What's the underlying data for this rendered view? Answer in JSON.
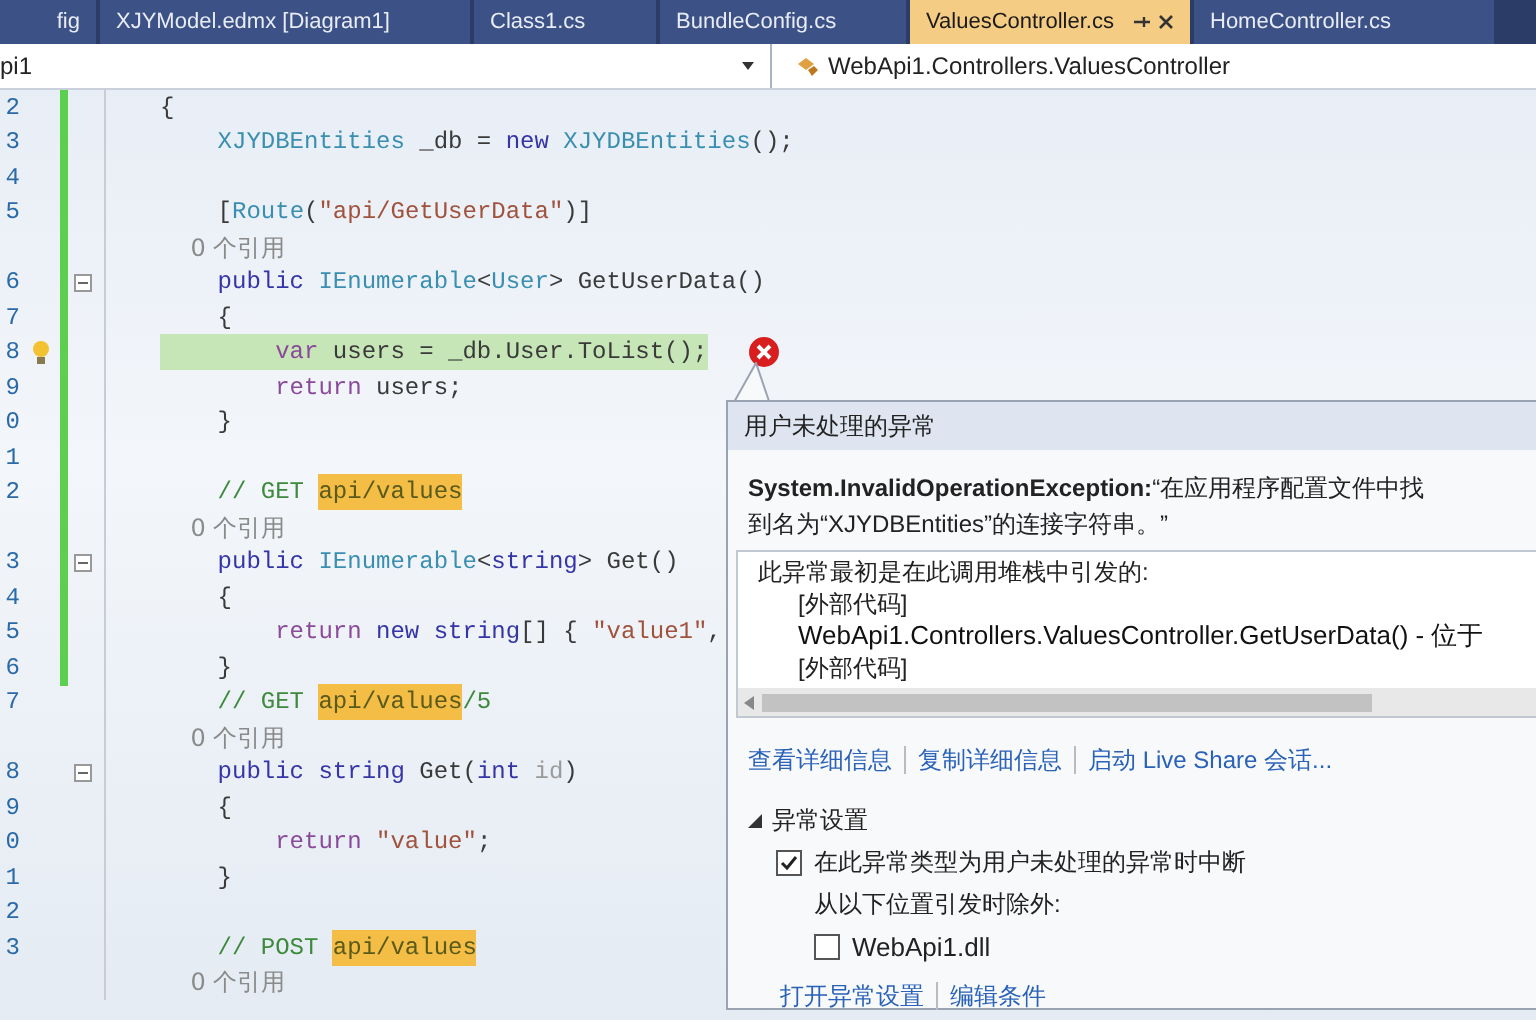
{
  "tabs": [
    {
      "label": "fig",
      "selected": false
    },
    {
      "label": "XJYModel.edmx [Diagram1]",
      "selected": false
    },
    {
      "label": "Class1.cs",
      "selected": false
    },
    {
      "label": "BundleConfig.cs",
      "selected": false
    },
    {
      "label": "ValuesController.cs",
      "selected": true
    },
    {
      "label": "HomeController.cs",
      "selected": false
    }
  ],
  "nav_bar": {
    "project": "pi1",
    "class": "WebApi1.Controllers.ValuesController"
  },
  "code_lines": [
    {
      "number": "2",
      "changed": true,
      "tokens": [
        {
          "kind": "plain",
          "text": "{"
        }
      ]
    },
    {
      "number": "3",
      "changed": true,
      "tokens": [
        {
          "kind": "type",
          "text": "    XJYDBEntities"
        },
        {
          "kind": "plain",
          "text": " _db = "
        },
        {
          "kind": "keyword",
          "text": "new"
        },
        {
          "kind": "type",
          "text": " XJYDBEntities"
        },
        {
          "kind": "plain",
          "text": "();"
        }
      ]
    },
    {
      "number": "4",
      "changed": true
    },
    {
      "number": "5",
      "changed": true,
      "tokens": [
        {
          "kind": "plain",
          "text": "    ["
        },
        {
          "kind": "type",
          "text": "Route"
        },
        {
          "kind": "plain",
          "text": "("
        },
        {
          "kind": "string",
          "text": "\"api/GetUserData\""
        },
        {
          "kind": "plain",
          "text": ")]"
        }
      ]
    },
    {
      "changed": true,
      "tokens": [
        {
          "kind": "reference",
          "text": "    0 个引用"
        }
      ]
    },
    {
      "number": "6",
      "changed": true,
      "fold": true,
      "tokens": [
        {
          "kind": "keyword",
          "text": "    public"
        },
        {
          "kind": "type",
          "text": " IEnumerable"
        },
        {
          "kind": "plain",
          "text": "<"
        },
        {
          "kind": "type",
          "text": "User"
        },
        {
          "kind": "plain",
          "text": "> GetUserData()"
        }
      ]
    },
    {
      "number": "7",
      "changed": true,
      "tokens": [
        {
          "kind": "plain",
          "text": "    {"
        }
      ]
    },
    {
      "number": "8",
      "changed": true,
      "highlighted": true,
      "lightbulb": true,
      "error": true,
      "tokens": [
        {
          "kind": "control",
          "text": "        var"
        },
        {
          "kind": "plain",
          "text": " users = _db.User.ToList();"
        }
      ]
    },
    {
      "number": "9",
      "changed": true,
      "tokens": [
        {
          "kind": "control",
          "text": "        return"
        },
        {
          "kind": "plain",
          "text": " users;"
        }
      ]
    },
    {
      "number": "0",
      "changed": true,
      "tokens": [
        {
          "kind": "plain",
          "text": "    }"
        }
      ]
    },
    {
      "number": "1",
      "changed": true
    },
    {
      "number": "2",
      "changed": true,
      "tokens": [
        {
          "kind": "comment",
          "text": "    // GET "
        },
        {
          "kind": "match",
          "text": "api/values"
        }
      ]
    },
    {
      "changed": true,
      "tokens": [
        {
          "kind": "reference",
          "text": "    0 个引用"
        }
      ]
    },
    {
      "number": "3",
      "changed": true,
      "fold": true,
      "tokens": [
        {
          "kind": "keyword",
          "text": "    public"
        },
        {
          "kind": "type",
          "text": " IEnumerable"
        },
        {
          "kind": "plain",
          "text": "<"
        },
        {
          "kind": "keyword",
          "text": "string"
        },
        {
          "kind": "plain",
          "text": "> Get()"
        }
      ]
    },
    {
      "number": "4",
      "changed": true,
      "tokens": [
        {
          "kind": "plain",
          "text": "    {"
        }
      ]
    },
    {
      "number": "5",
      "changed": true,
      "tokens": [
        {
          "kind": "control",
          "text": "        return"
        },
        {
          "kind": "keyword",
          "text": " new string"
        },
        {
          "kind": "plain",
          "text": "[] { "
        },
        {
          "kind": "string",
          "text": "\"value1\""
        },
        {
          "kind": "plain",
          "text": ","
        }
      ]
    },
    {
      "number": "6",
      "changed": true,
      "tokens": [
        {
          "kind": "plain",
          "text": "    }"
        }
      ]
    },
    {
      "number": "7",
      "changed": false,
      "tokens": [
        {
          "kind": "comment",
          "text": "    // GET "
        },
        {
          "kind": "match",
          "text": "api/values"
        },
        {
          "kind": "comment",
          "text": "/5"
        }
      ]
    },
    {
      "changed": false,
      "tokens": [
        {
          "kind": "reference",
          "text": "    0 个引用"
        }
      ]
    },
    {
      "number": "8",
      "changed": false,
      "fold": true,
      "tokens": [
        {
          "kind": "keyword",
          "text": "    public string"
        },
        {
          "kind": "plain",
          "text": " Get("
        },
        {
          "kind": "keyword",
          "text": "int"
        },
        {
          "kind": "faded",
          "text": " id"
        },
        {
          "kind": "plain",
          "text": ")"
        }
      ]
    },
    {
      "number": "9",
      "changed": false,
      "tokens": [
        {
          "kind": "plain",
          "text": "    {"
        }
      ]
    },
    {
      "number": "0",
      "changed": false,
      "tokens": [
        {
          "kind": "control",
          "text": "        return"
        },
        {
          "kind": "string",
          "text": " \"value\""
        },
        {
          "kind": "plain",
          "text": ";"
        }
      ]
    },
    {
      "number": "1",
      "changed": false,
      "tokens": [
        {
          "kind": "plain",
          "text": "    }"
        }
      ]
    },
    {
      "number": "2",
      "changed": false
    },
    {
      "number": "3",
      "changed": false,
      "tokens": [
        {
          "kind": "comment",
          "text": "    // POST "
        },
        {
          "kind": "match",
          "text": "api/values"
        }
      ]
    },
    {
      "changed": false,
      "tokens": [
        {
          "kind": "reference",
          "text": "    0 个引用"
        }
      ]
    }
  ],
  "exception_popup": {
    "title": "用户未处理的异常",
    "message_lines": [
      "**System.InvalidOperationException:**“在应用程序配置文件中找",
      "到名为“XJYDBEntities”的连接字符串。”"
    ],
    "stack_trace": [
      {
        "kind": "heading",
        "text": "此异常最初是在此调用堆栈中引发的:"
      },
      {
        "kind": "frame",
        "text": "[外部代码]"
      },
      {
        "kind": "frame_main",
        "text": "WebApi1.Controllers.ValuesController.GetUserData() - 位于"
      },
      {
        "kind": "frame",
        "text": "[外部代码]"
      }
    ],
    "links": [
      "查看详细信息",
      "复制详细信息",
      "启动 Live Share 会话..."
    ],
    "settings": {
      "title": "异常设置",
      "expanded": true,
      "break_option": {
        "label": "在此异常类型为用户未处理的异常时中断",
        "checked": true
      },
      "except_label": "从以下位置引发时除外:",
      "modules": [
        {
          "label": "WebApi1.dll",
          "checked": false
        }
      ]
    },
    "footer_links": [
      "打开异常设置",
      "编辑条件"
    ]
  }
}
